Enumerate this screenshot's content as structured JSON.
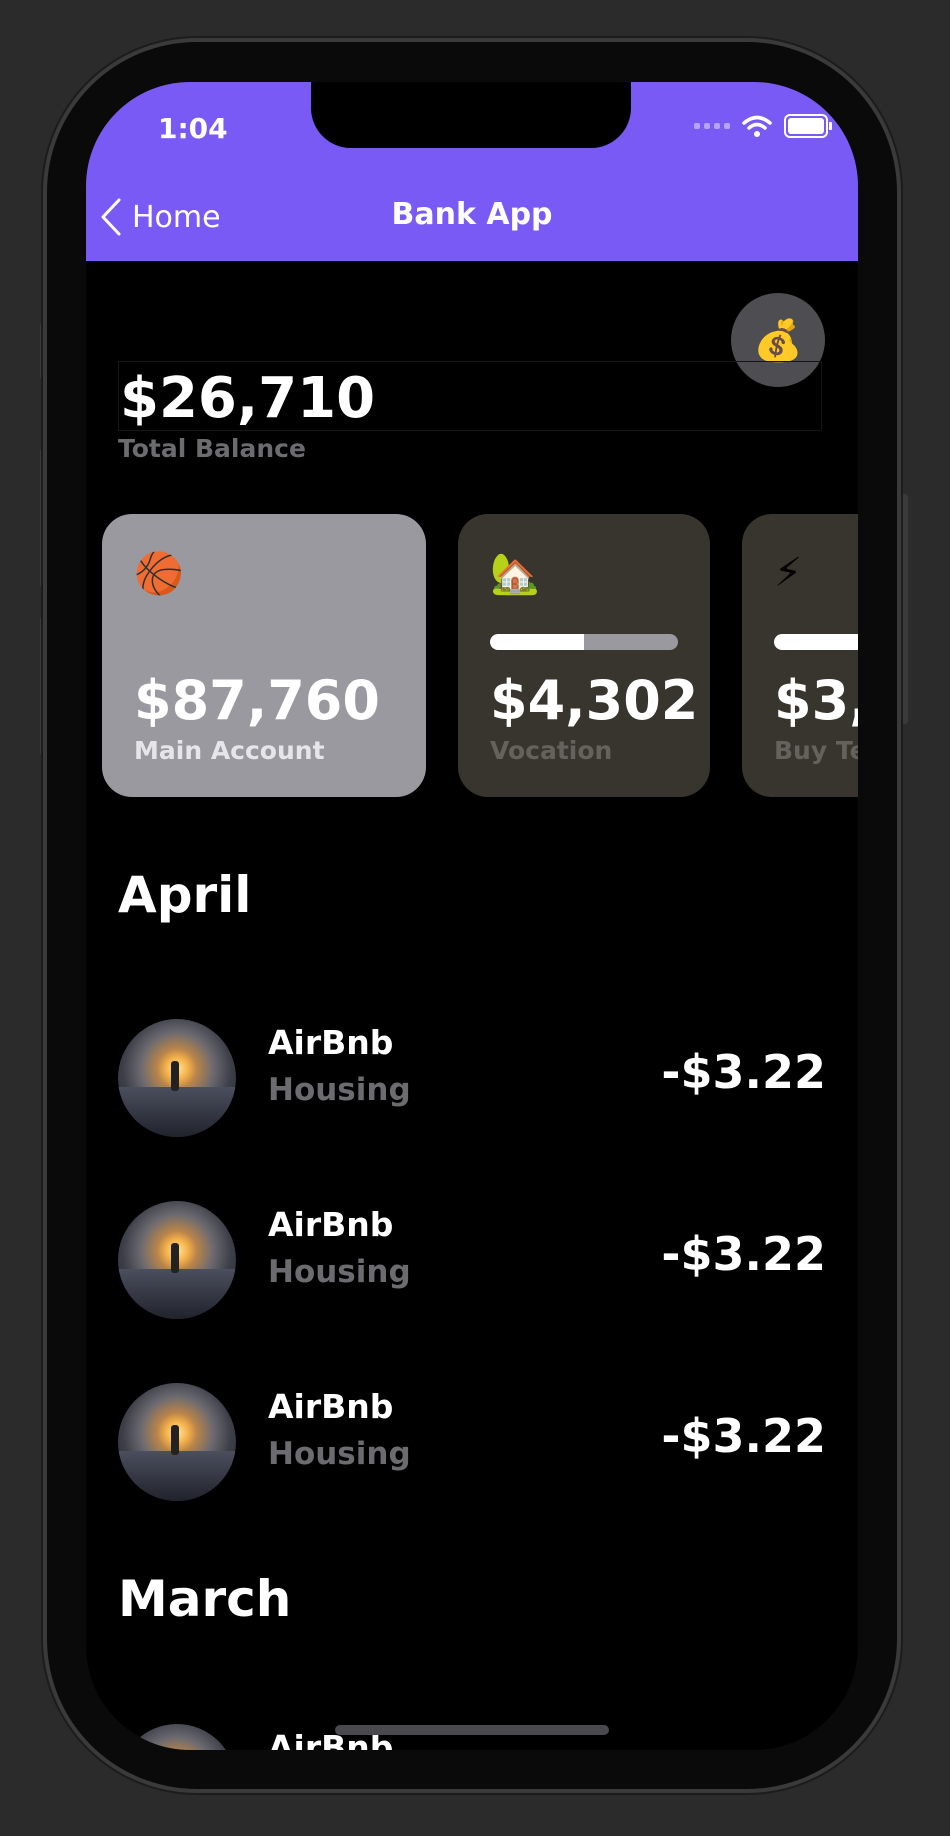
{
  "status_bar": {
    "time": "1:04"
  },
  "nav": {
    "back_label": "Home",
    "title": "Bank App"
  },
  "summary": {
    "coin_icon": "money-bag",
    "total": "$26,710",
    "total_label": "Total Balance"
  },
  "accounts": [
    {
      "emoji": "🏀",
      "amount": "$87,760",
      "label": "Main Account",
      "bg": "#9a99a0",
      "label_color": "#e6e6ea",
      "progress": null
    },
    {
      "emoji": "🏡",
      "amount": "$4,302",
      "label": "Vocation",
      "bg": "#38352f",
      "label_color": "#65625d",
      "progress": 0.5
    },
    {
      "emoji": "⚡",
      "amount": "$3,",
      "label": "Buy Te",
      "bg": "#38352f",
      "label_color": "#65625d",
      "progress": 1.0
    }
  ],
  "sections": [
    {
      "title": "April",
      "transactions": [
        {
          "name": "AirBnb",
          "category": "Housing",
          "amount": "-$3.22"
        },
        {
          "name": "AirBnb",
          "category": "Housing",
          "amount": "-$3.22"
        },
        {
          "name": "AirBnb",
          "category": "Housing",
          "amount": "-$3.22"
        }
      ]
    },
    {
      "title": "March",
      "transactions": [
        {
          "name": "AirBnb",
          "category": "",
          "amount": ""
        }
      ]
    }
  ],
  "colors": {
    "accent": "#7a5af5",
    "background": "#000000",
    "muted_text": "#6c6c70"
  }
}
